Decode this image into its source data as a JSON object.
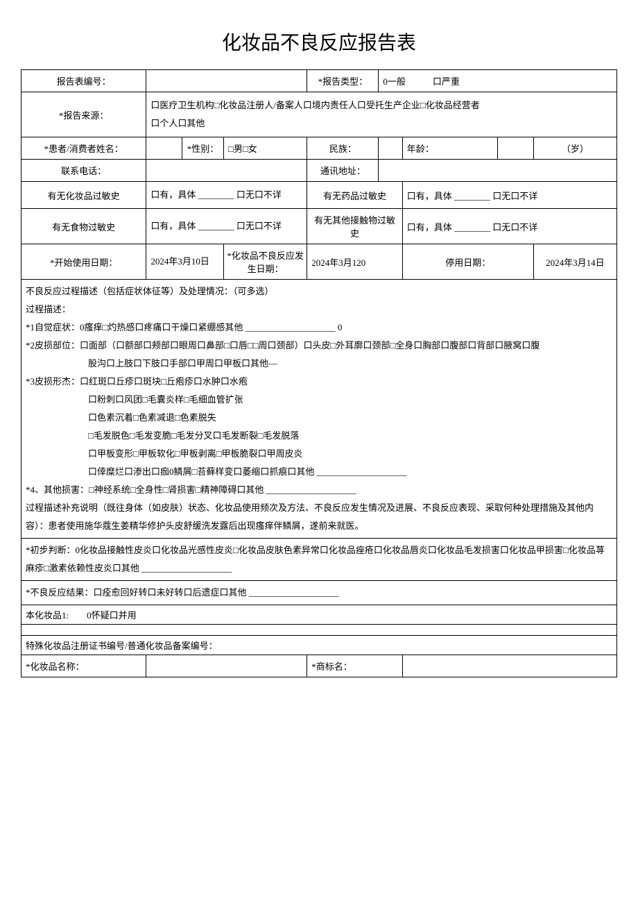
{
  "title": "化妆品不良反应报告表",
  "rows": {
    "report_no_label": "报告表编号：",
    "report_type_label": "*报告类型：",
    "report_type_opts": "0一般　　　口严重",
    "report_source_label": "*报告来源：",
    "report_source_opts": "口医疗卫生机构□化妆品注册人/备案人口境内责任人口受托生产企业□化妆品经营者\n口个人口其他",
    "patient_name_label": "*患者/消费者姓名：",
    "gender_label": "*性别：",
    "gender_opts": "□男□女",
    "ethnic_label": "民族：",
    "age_label": "年龄：",
    "age_unit": "（岁）",
    "phone_label": "联系电话：",
    "address_label": "通讯地址：",
    "cosmetic_allergy_label": "有无化妆品过敏史",
    "cosmetic_allergy_opts": "口有，具体 ________ 口无口不详",
    "drug_allergy_label": "有无药品过敏史",
    "drug_allergy_opts": "口有，具体 ________ 口无口不详",
    "food_allergy_label": "有无食物过敏史",
    "food_allergy_opts": "口有，具体 ________ 口无口不详",
    "other_allergy_label": "有无其他接触物过敏史",
    "other_allergy_opts": "口有，具体 ________ 口无口不详",
    "start_date_label": "*开始使用日期：",
    "start_date_value": "2024年3月10日",
    "reaction_date_label": "*化妆品不良反应发生日期：",
    "reaction_date_value": "2024年3月120",
    "stop_date_label": "停用日期：",
    "stop_date_value": "2024年3月14日"
  },
  "description": {
    "header": "不良反应过程描述（包括症状体征等）及处理情况：（可多选）",
    "process_label": "过程描述：",
    "s1": "*1自觉症状：0瘙痒□灼热感口疼痛口干燥口紧绷感其他 ____________________ 0",
    "s2_a": "*2皮损部位：口面部（口额部口颊部口眼周口鼻部□口唇□□周口颈部）口头皮□外耳廓口颈部□全身口胸部口腹部口背部口腋窝口腹",
    "s2_b": "股沟口上肢口下肢口手部口甲周口甲板口其他—",
    "s3_a": "*3皮损形杰：口红斑口丘疹口斑块□丘疱疹口水肿口水疱",
    "s3_b": "口粉刺口风团□毛囊炎样□毛细血管扩张",
    "s3_c": "口色素沉着□色素减退□色素脱失",
    "s3_d": "□毛发脱色□毛发变脆□毛发分叉口毛发断裂□毛发脱落",
    "s3_e": "口甲板变形□甲板软化□甲板剥离□甲板脆裂口甲周皮炎",
    "s3_f": "口倖糜烂口渗出口痂0鳞屑□苔藓样变口萎缩口抓痕口其他 ____________________",
    "s4": "*4、其他损害：□神经系统□全身性□肾损害□精神障碍口其他 ____________________",
    "supplement": "过程描述补充说明（既往身体（如皮肤）状态、化妆品使用频次及方法、不良反应发生情况及进展、不良反应表现、采取何种处理措施及其他内容）：患者使用施华蔻生姜精华修护头皮舒缓洗发露后出现瘙痒伴鳞屑，遂前来就医。",
    "judgment": "*初步判断：0化妆品接触性皮炎口化妆品光感性皮炎□化妆品皮肤色素异常口化妆品痤疮口化妆品唇炎口化妆品毛发损害口化妆品甲损害□化妆品荨麻疹□激素依赖性皮炎口其他 ____________________",
    "result": "*不良反应结果：口痊愈回好转口未好转口后遗症口其他 ____________________",
    "product1": "本化妆品1:　　0怀疑口并用",
    "reg_no": "特殊化妆品注册证书编号/普通化妆品备案编号：",
    "product_name_label": "*化妆品名称：",
    "brand_label": "*商标名："
  }
}
